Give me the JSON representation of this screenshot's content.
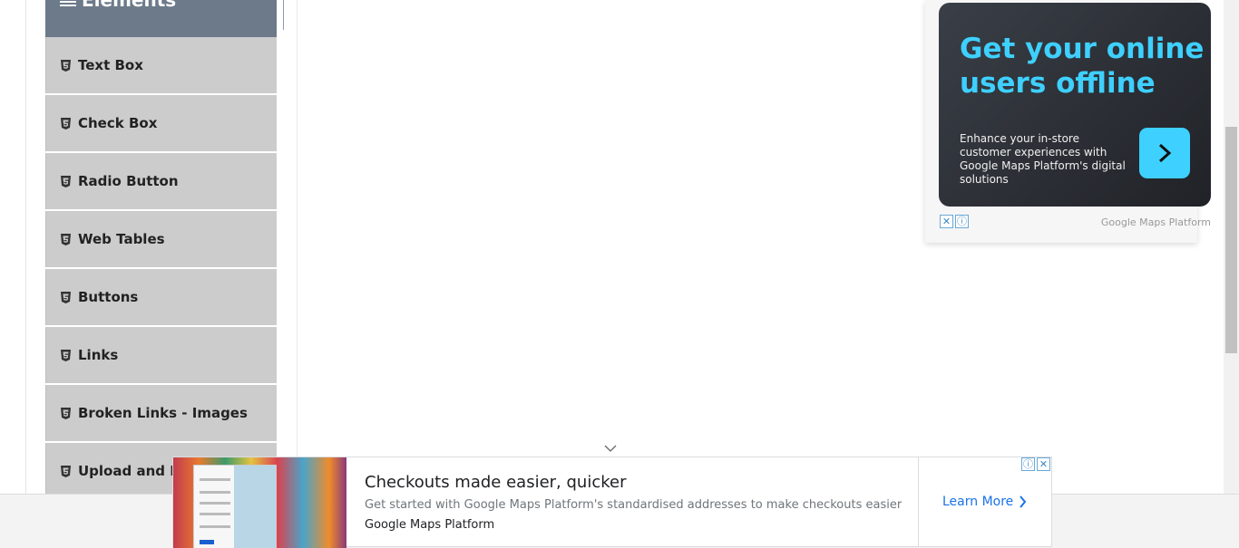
{
  "sidebar": {
    "group_title": "Elements",
    "items": [
      {
        "label": "Text Box"
      },
      {
        "label": "Check Box"
      },
      {
        "label": "Radio Button"
      },
      {
        "label": "Web Tables"
      },
      {
        "label": "Buttons"
      },
      {
        "label": "Links"
      },
      {
        "label": "Broken Links - Images"
      },
      {
        "label": "Upload and Do"
      }
    ]
  },
  "ad_right": {
    "headline": "Get your online users offline",
    "body": "Enhance your in-store customer experiences with Google Maps Platform's digital solutions",
    "brand": "Google Maps Platform",
    "accent_color": "#3ed0ff"
  },
  "ad_bottom": {
    "headline": "Checkouts made easier, quicker",
    "description": "Get started with Google Maps Platform's standardised addresses to make checkouts easier",
    "advertiser": "Google Maps Platform",
    "cta": "Learn More",
    "cta_color": "#1a73e8"
  },
  "icons": {
    "menu_item": "html5-icon",
    "group_header": "hamburger-icon",
    "collapse": "upload-icon"
  }
}
